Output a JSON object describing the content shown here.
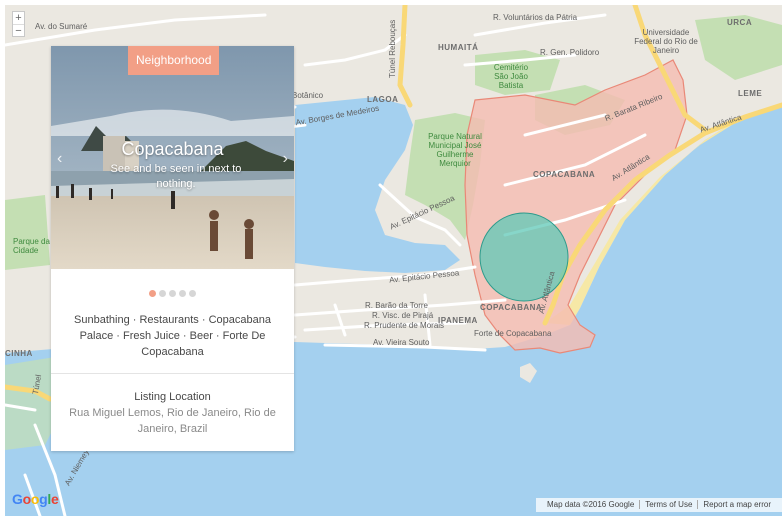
{
  "map": {
    "zoom_in": "+",
    "zoom_out": "−",
    "labels": {
      "sumare": "Av. do Sumaré",
      "voluntarios": "R. Voluntários da Pátria",
      "gen_polidoro": "R. Gen. Polidoro",
      "humaita": "HUMAITÁ",
      "tunel_rebouças": "Túnel Rebouças",
      "urca": "URCA",
      "universidade": "Universidade Federal do Rio de Janeiro",
      "cemiterio": "Cemitério São João Batista",
      "botanico": "Botânico",
      "lagoa": "LAGOA",
      "borges": "Av. Borges de Medeiros",
      "barata": "R. Barata Ribeiro",
      "leme": "LEME",
      "atlantica_north": "Av. Atlântica",
      "parque_lage": "Parque Natural Municipal José Guilherme Merquior",
      "copacabana_1": "COPACABANA",
      "atlantica_main": "Av. Atlântica",
      "epitacio_1": "Av. Epitácio Pessoa",
      "parque_cidade": "Parque da Cidade",
      "epitacio_2": "Av. Epitácio Pessoa",
      "atlantica_v": "Av. Atlântica",
      "barao": "R. Barão da Torre",
      "piraja": "R. Visc. de Pirajá",
      "prudente": "R. Prudente de Morais",
      "ipanema": "IPANEMA",
      "copacabana_2": "COPACABANA",
      "forte": "Forte de Copacabana",
      "vieira": "Av. Vieira Souto",
      "rocinha": "CINHA",
      "tunel": "Túnel",
      "niemeyer": "Av. Niemeyer"
    }
  },
  "card": {
    "badge": "Neighborhood",
    "title": "Copacabana",
    "subtitle": "See and be seen in next to nothing.",
    "prev": "‹",
    "next": "›",
    "tags": "Sunbathing · Restaurants · Copacabana Palace · Fresh Juice · Beer · Forte De Copacabana",
    "location_title": "Listing Location",
    "location_text": "Rua Miguel Lemos, Rio de Janeiro, Rio de Janeiro, Brazil",
    "carousel": {
      "count": 5,
      "active": 1
    }
  },
  "footer": {
    "logo": "Google",
    "map_data": "Map data ©2016 Google",
    "terms": "Terms of Use",
    "report": "Report a map error"
  },
  "colors": {
    "water": "#a4d0ef",
    "land": "#ebe8e1",
    "park": "#c4dfb3",
    "neighborhood_fill": "#f5bcb1",
    "neighborhood_stroke": "#e98877",
    "marker_fill": "#5fc8b7",
    "accent": "#f29f86"
  }
}
